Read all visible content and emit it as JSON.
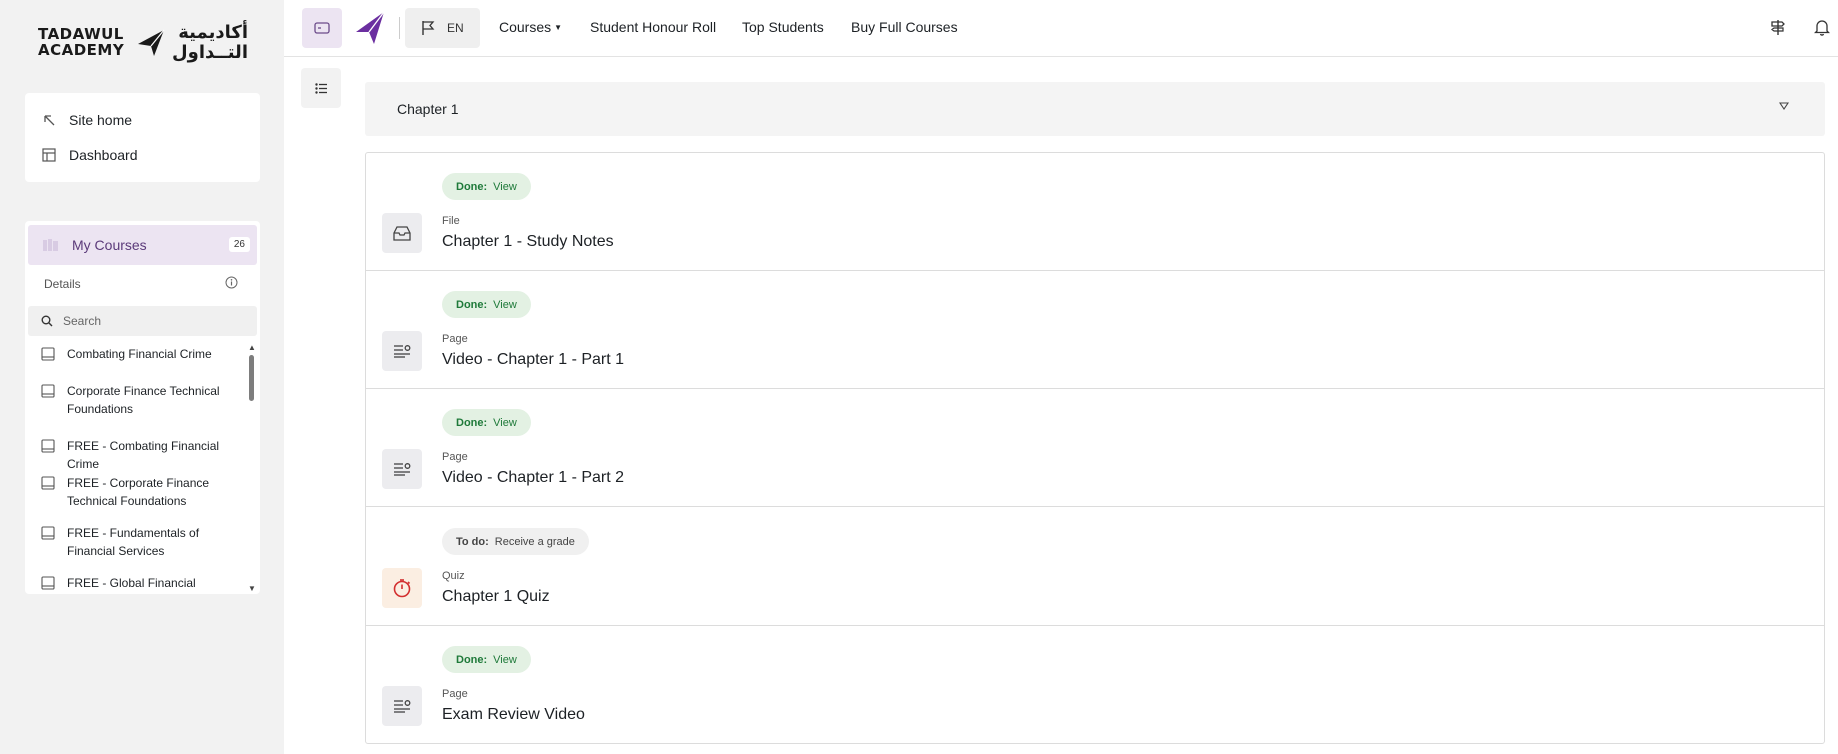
{
  "logo": {
    "latin_line1": "TADAWUL",
    "latin_line2": "ACADEMY",
    "arabic_line1": "أكاديمية",
    "arabic_line2": "التــداول"
  },
  "nav": {
    "site_home": "Site home",
    "dashboard": "Dashboard"
  },
  "my_courses": {
    "label": "My Courses",
    "count": "26",
    "details_label": "Details",
    "search_placeholder": "Search",
    "items": [
      {
        "label": "Combating Financial Crime"
      },
      {
        "label": "Corporate Finance Technical Foundations"
      },
      {
        "label": "FREE - Combating Financial Crime"
      },
      {
        "label": "FREE - Corporate Finance Technical Foundations"
      },
      {
        "label": "FREE - Fundamentals of Financial Services"
      },
      {
        "label": "FREE - Global Financial"
      }
    ]
  },
  "topnav": {
    "lang": "EN",
    "courses": "Courses",
    "honour_roll": "Student Honour Roll",
    "top_students": "Top Students",
    "buy_full": "Buy Full Courses"
  },
  "section": {
    "title": "Chapter 1"
  },
  "activities": [
    {
      "status_label": "Done:",
      "status_text": "View",
      "status": "done",
      "type": "File",
      "name": "Chapter 1 - Study Notes",
      "icon": "file-icon"
    },
    {
      "status_label": "Done:",
      "status_text": "View",
      "status": "done",
      "type": "Page",
      "name": "Video - Chapter 1 - Part 1",
      "icon": "page-icon"
    },
    {
      "status_label": "Done:",
      "status_text": "View",
      "status": "done",
      "type": "Page",
      "name": "Video - Chapter 1 - Part 2",
      "icon": "page-icon"
    },
    {
      "status_label": "To do:",
      "status_text": "Receive a grade",
      "status": "todo",
      "type": "Quiz",
      "name": "Chapter 1 Quiz",
      "icon": "quiz-timer-icon"
    },
    {
      "status_label": "Done:",
      "status_text": "View",
      "status": "done",
      "type": "Page",
      "name": "Exam Review Video",
      "icon": "page-icon"
    }
  ],
  "colors": {
    "accent": "#6b4a8a",
    "done_bg": "#e3f1e3",
    "done_text": "#1f7a3a",
    "quiz_icon": "#d32f2f"
  }
}
